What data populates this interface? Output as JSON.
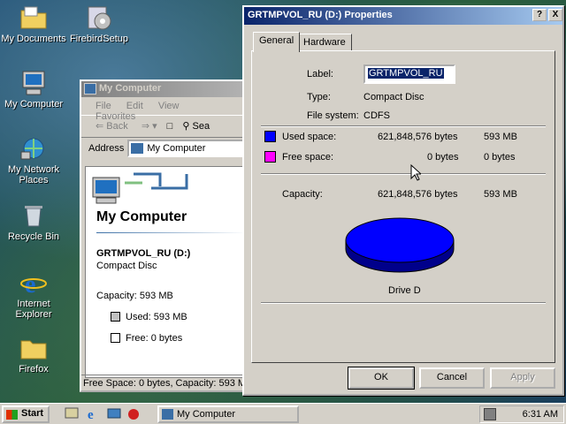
{
  "desktop": {
    "icons": [
      {
        "label": "My Documents"
      },
      {
        "label": "FirebirdSetup"
      },
      {
        "label": "My Computer"
      },
      {
        "label": "My Network Places"
      },
      {
        "label": "Recycle Bin"
      },
      {
        "label": "Internet Explorer"
      },
      {
        "label": "Firefox"
      }
    ]
  },
  "explorer": {
    "title": "My Computer",
    "menu": [
      "File",
      "Edit",
      "View",
      "Favorites"
    ],
    "toolbar": {
      "back": "Back",
      "search": "Sea"
    },
    "address_label": "Address",
    "address_value": "My Computer",
    "heading": "My Computer",
    "drive_name": "GRTMPVOL_RU (D:)",
    "drive_type": "Compact Disc",
    "capacity": "Capacity: 593 MB",
    "used": "Used: 593 MB",
    "free": "Free: 0 bytes",
    "status": "Free Space: 0 bytes, Capacity: 593 M"
  },
  "dialog": {
    "title": "GRTMPVOL_RU (D:) Properties",
    "help_btn": "?",
    "close_btn": "X",
    "tabs": [
      "General",
      "Hardware"
    ],
    "label_caption": "Label:",
    "label_value": "GRTMPVOL_RU",
    "type_caption": "Type:",
    "type_value": "Compact Disc",
    "fs_caption": "File system:",
    "fs_value": "CDFS",
    "used_caption": "Used space:",
    "used_bytes": "621,848,576 bytes",
    "used_mb": "593 MB",
    "free_caption": "Free space:",
    "free_bytes": "0 bytes",
    "free_mb": "0 bytes",
    "capacity_caption": "Capacity:",
    "capacity_bytes": "621,848,576 bytes",
    "capacity_mb": "593 MB",
    "drive_caption": "Drive D",
    "buttons": {
      "ok": "OK",
      "cancel": "Cancel",
      "apply": "Apply"
    },
    "colors": {
      "used": "#0000ff",
      "free": "#ff00ff"
    }
  },
  "taskbar": {
    "start": "Start",
    "task": "My Computer",
    "clock": "6:31 AM"
  }
}
